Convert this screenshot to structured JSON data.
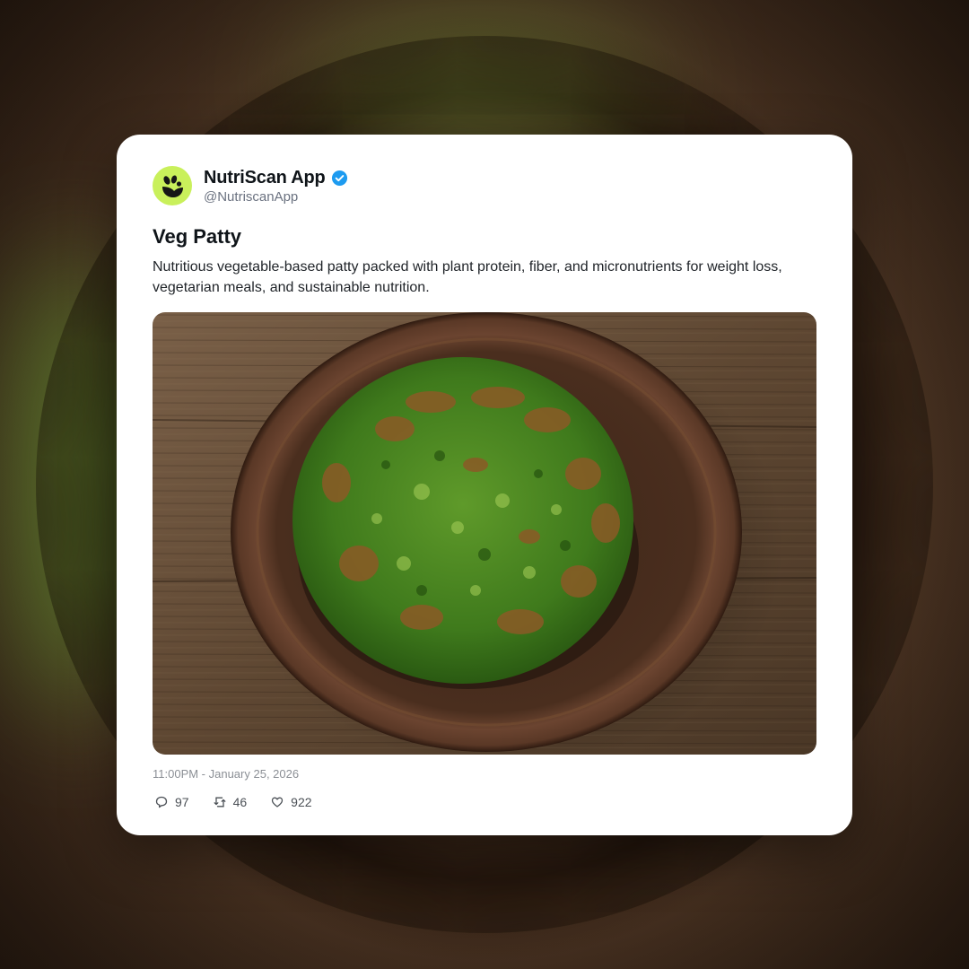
{
  "account": {
    "display_name": "NutriScan App",
    "handle": "@NutriscanApp",
    "verified": true,
    "avatar_color": "#c9f05b",
    "avatar_icon": "leaf-seed-logo-icon"
  },
  "post": {
    "title": "Veg Patty",
    "body": "Nutritious vegetable-based patty packed with plant protein, fiber, and micronutrients for weight loss, vegetarian meals, and sustainable nutrition.",
    "media_icon": "veg-patty-photo",
    "timestamp": "11:00PM - January 25, 2026"
  },
  "actions": {
    "replies": {
      "icon": "comment-icon",
      "count": "97"
    },
    "reposts": {
      "icon": "repost-icon",
      "count": "46"
    },
    "likes": {
      "icon": "heart-icon",
      "count": "922"
    }
  },
  "colors": {
    "verified_badge": "#1d9bf0",
    "card_background": "#ffffff"
  }
}
